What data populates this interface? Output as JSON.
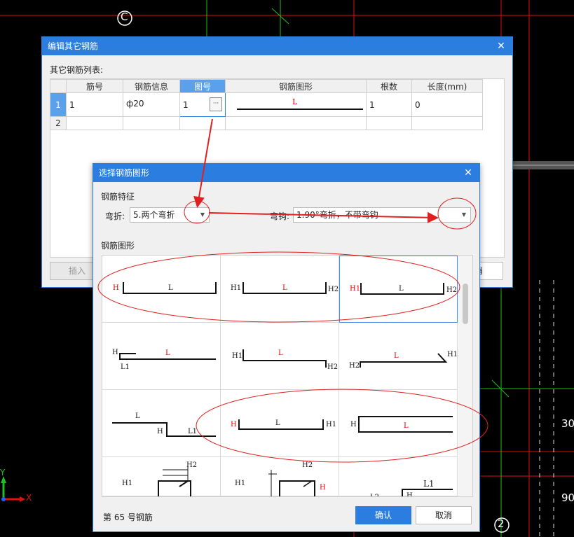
{
  "axes": {
    "c_label": "C",
    "two_label": "2",
    "y_label": "Y",
    "x_label": "X",
    "right_val1": "30",
    "right_val2": "90"
  },
  "edit_dialog": {
    "title": "编辑其它钢筋",
    "list_label": "其它钢筋列表:",
    "columns": [
      "筋号",
      "钢筋信息",
      "图号",
      "钢筋图形",
      "根数",
      "长度(mm)"
    ],
    "rows": [
      {
        "num": "1",
        "bar_no": "1",
        "info": "ф20",
        "fig_no": "1",
        "shape_label": "L",
        "count": "1",
        "length": "0"
      },
      {
        "num": "2",
        "bar_no": "",
        "info": "",
        "fig_no": "",
        "shape_label": "",
        "count": "",
        "length": ""
      }
    ],
    "insert_button": "插入",
    "cancel_fragment": "消",
    "ellipsis": "···"
  },
  "select_dialog": {
    "title": "选择钢筋图形",
    "feature_label": "钢筋特征",
    "bend_label": "弯折:",
    "bend_value": "5.两个弯折",
    "hook_label": "弯钩:",
    "hook_value": "1.90°弯折，不带弯钩",
    "shape_label": "钢筋图形",
    "status": "第 65 号钢筋",
    "ok_button": "确认",
    "cancel_button": "取消",
    "shapes": {
      "s1": [
        "H",
        "L"
      ],
      "s2": [
        "H1",
        "L",
        "H2"
      ],
      "s3": [
        "H1",
        "L",
        "H2"
      ],
      "s4": [
        "H",
        "L",
        "L1"
      ],
      "s5": [
        "H1",
        "L",
        "H2"
      ],
      "s6": [
        "L",
        "H1",
        "H2"
      ],
      "s7": [
        "L",
        "H",
        "L1"
      ],
      "s8": [
        "H",
        "L",
        "H1"
      ],
      "s9": [
        "H",
        "L"
      ],
      "s10": [
        "H2",
        "H1"
      ],
      "s11": [
        "H2",
        "H1",
        "H"
      ],
      "s12": [
        "L1",
        "L2",
        "H"
      ]
    }
  },
  "colors": {
    "accent": "#2b7ee0",
    "annotation": "#e02020",
    "cad_green": "#1fc01f",
    "cad_red": "#e01010"
  }
}
